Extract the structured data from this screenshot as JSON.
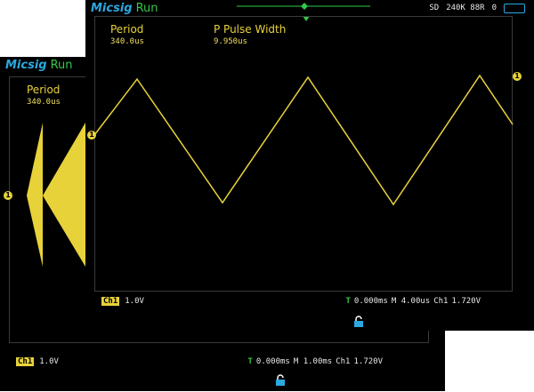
{
  "colors": {
    "trace": "#e8d23a",
    "brand": "#2aa8e0",
    "run": "#34c84a",
    "background": "#000000"
  },
  "back": {
    "brand": "Micsig",
    "run_status": "Run",
    "measure": {
      "label": "Period",
      "value": "340.0us"
    },
    "channel_tag": "Ch1",
    "volts_div": "1.0V",
    "trigger_icon": "T",
    "trigger_offset": "0.000ms",
    "timebase": "M 1.00ms",
    "trigger_source": "Ch1",
    "trigger_level": "1.720V",
    "marker": "1"
  },
  "front": {
    "brand": "Micsig",
    "run_status": "Run",
    "mode": "SD",
    "memory_depth": "240K 88R",
    "status_count": "0",
    "measure1": {
      "label": "Period",
      "value": "340.0us"
    },
    "measure2": {
      "label": "P Pulse Width",
      "value": "9.950us"
    },
    "channel_tag": "Ch1",
    "volts_div": "1.0V",
    "trigger_icon": "T",
    "trigger_offset": "0.000ms",
    "timebase": "M 4.00us",
    "trigger_source": "Ch1",
    "trigger_level": "1.720V",
    "marker": "1"
  }
}
